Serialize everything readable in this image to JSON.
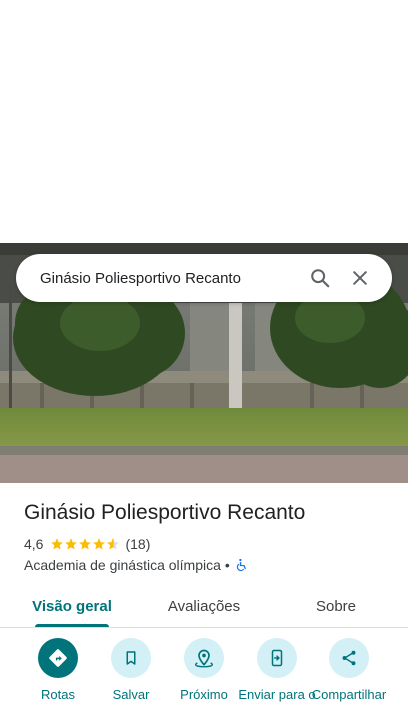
{
  "search": {
    "query": "Ginásio Poliesportivo Recanto"
  },
  "place": {
    "name": "Ginásio Poliesportivo Recanto",
    "rating": "4,6",
    "rating_value": 4.6,
    "review_count": "(18)",
    "category": "Academia de ginástica olímpica",
    "separator": "•",
    "accessibility_icon": "wheelchair-icon"
  },
  "tabs": [
    {
      "label": "Visão geral",
      "active": true
    },
    {
      "label": "Avaliações",
      "active": false
    },
    {
      "label": "Sobre",
      "active": false
    }
  ],
  "actions": [
    {
      "label": "Rotas",
      "icon": "directions-icon"
    },
    {
      "label": "Salvar",
      "icon": "bookmark-icon"
    },
    {
      "label": "Próximo",
      "icon": "nearby-icon"
    },
    {
      "label": "Enviar para o",
      "icon": "send-to-phone-icon"
    },
    {
      "label": "Compartilhar",
      "icon": "share-icon"
    }
  ],
  "colors": {
    "accent": "#00747a",
    "action_bg": "#d2f0f6",
    "star": "#fbbc04",
    "accessibility": "#1a73e8"
  }
}
